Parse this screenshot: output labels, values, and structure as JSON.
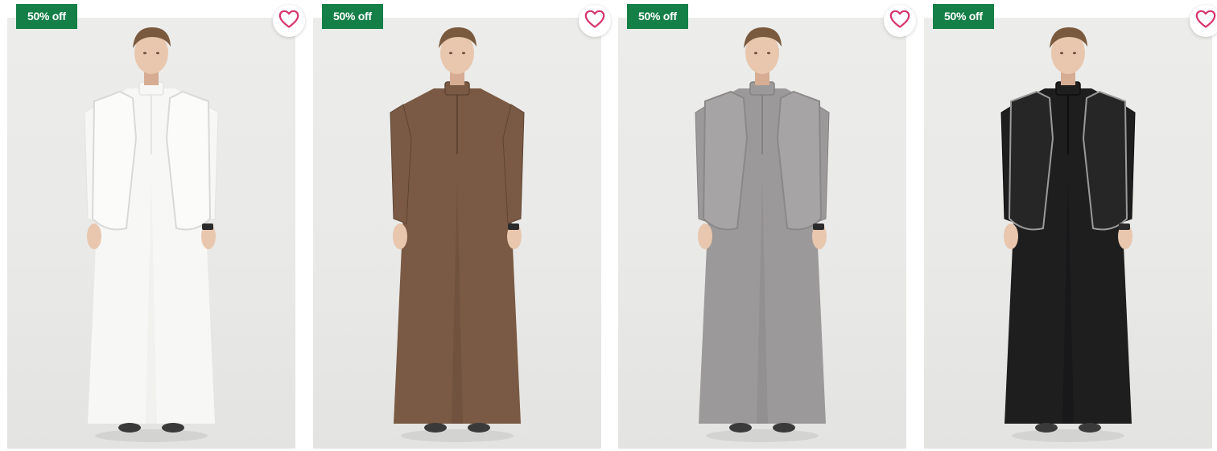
{
  "products": [
    {
      "badge": "50% off",
      "wishlist_icon": "heart-outline-icon",
      "garment": {
        "robe": "#f7f7f5",
        "robe_shade": "#e4e4e2",
        "vest": "#fbfbfa",
        "vest_trim": "#d9d9d7",
        "has_vest": true
      }
    },
    {
      "badge": "50% off",
      "wishlist_icon": "heart-outline-icon",
      "garment": {
        "robe": "#7a5a44",
        "robe_shade": "#5f4433",
        "vest": "#7a5a44",
        "vest_trim": "#5f4433",
        "has_vest": false
      }
    },
    {
      "badge": "50% off",
      "wishlist_icon": "heart-outline-icon",
      "garment": {
        "robe": "#9c999a",
        "robe_shade": "#858283",
        "vest": "#a7a4a5",
        "vest_trim": "#8b8889",
        "has_vest": true
      }
    },
    {
      "badge": "50% off",
      "wishlist_icon": "heart-outline-icon",
      "garment": {
        "robe": "#1e1e1f",
        "robe_shade": "#0f0f10",
        "vest": "#262627",
        "vest_trim": "#9a9a9a",
        "has_vest": true
      }
    }
  ],
  "colors": {
    "badge_bg": "#147f46",
    "badge_text": "#ffffff",
    "heart": "#d6336c"
  }
}
